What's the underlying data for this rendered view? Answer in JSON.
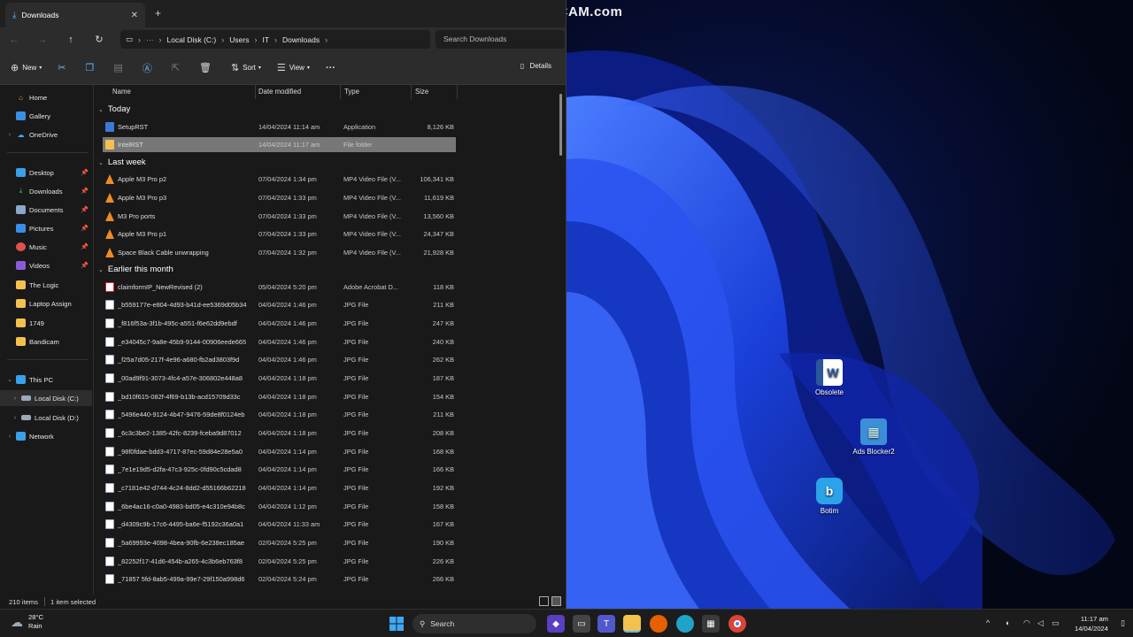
{
  "watermark": "www.BANDICAM.com",
  "explorer": {
    "tab_title": "Downloads",
    "breadcrumbs": [
      "Local Disk (C:)",
      "Users",
      "IT",
      "Downloads"
    ],
    "search_placeholder": "Search Downloads",
    "commands": {
      "new": "New",
      "sort": "Sort",
      "view": "View",
      "more": "···",
      "details": "Details"
    },
    "columns": {
      "name": "Name",
      "date": "Date modified",
      "type": "Type",
      "size": "Size"
    },
    "nav": {
      "home": "Home",
      "gallery": "Gallery",
      "onedrive": "OneDrive",
      "desktop": "Desktop",
      "downloads": "Downloads",
      "documents": "Documents",
      "pictures": "Pictures",
      "music": "Music",
      "videos": "Videos",
      "thelogic": "The Logic",
      "laptop": "Laptop Assign",
      "f1749": "1749",
      "bandicam": "Bandicam",
      "thispc": "This PC",
      "diskc": "Local Disk (C:)",
      "diskd": "Local Disk (D:)",
      "network": "Network"
    },
    "groups": {
      "today": "Today",
      "lastweek": "Last week",
      "earlier": "Earlier this month"
    },
    "files": [
      {
        "name": "SetupRST",
        "date": "14/04/2024 11:14 am",
        "type": "Application",
        "size": "8,126 KB",
        "kind": "app"
      },
      {
        "name": "IntelRST",
        "date": "14/04/2024 11:17 am",
        "type": "File folder",
        "size": "",
        "kind": "folder"
      },
      {
        "name": "Apple M3 Pro p2",
        "date": "07/04/2024 1:34 pm",
        "type": "MP4 Video File (V...",
        "size": "106,341 KB",
        "kind": "vlc"
      },
      {
        "name": "Apple M3 Pro p3",
        "date": "07/04/2024 1:33 pm",
        "type": "MP4 Video File (V...",
        "size": "11,619 KB",
        "kind": "vlc"
      },
      {
        "name": "M3 Pro ports",
        "date": "07/04/2024 1:33 pm",
        "type": "MP4 Video File (V...",
        "size": "13,560 KB",
        "kind": "vlc"
      },
      {
        "name": "Apple M3 Pro p1",
        "date": "07/04/2024 1:33 pm",
        "type": "MP4 Video File (V...",
        "size": "24,347 KB",
        "kind": "vlc"
      },
      {
        "name": "Space Black Cable unwrapping",
        "date": "07/04/2024 1:32 pm",
        "type": "MP4 Video File (V...",
        "size": "21,928 KB",
        "kind": "vlc"
      },
      {
        "name": "claimformIP_NewRevised (2)",
        "date": "05/04/2024 5:20 pm",
        "type": "Adobe Acrobat D...",
        "size": "118 KB",
        "kind": "pdf"
      },
      {
        "name": "_b559177e-e804-4d93-b41d-ee5369d05b34",
        "date": "04/04/2024 1:46 pm",
        "type": "JPG File",
        "size": "211 KB",
        "kind": "jpg"
      },
      {
        "name": "_f816f53a-3f1b-495c-a551-f6e62dd9ebdf",
        "date": "04/04/2024 1:46 pm",
        "type": "JPG File",
        "size": "247 KB",
        "kind": "jpg"
      },
      {
        "name": "_e34045c7-9a8e-45b9-9144-00906eede665",
        "date": "04/04/2024 1:46 pm",
        "type": "JPG File",
        "size": "240 KB",
        "kind": "jpg"
      },
      {
        "name": "_f25a7d05-217f-4e96-a680-fb2ad3803f9d",
        "date": "04/04/2024 1:46 pm",
        "type": "JPG File",
        "size": "262 KB",
        "kind": "jpg"
      },
      {
        "name": "_00ad9f91-3073-4fc4-a57e-306802e448a8",
        "date": "04/04/2024 1:18 pm",
        "type": "JPG File",
        "size": "187 KB",
        "kind": "jpg"
      },
      {
        "name": "_bd10f615-082f-4f69-b13b-acd15709d33c",
        "date": "04/04/2024 1:18 pm",
        "type": "JPG File",
        "size": "154 KB",
        "kind": "jpg"
      },
      {
        "name": "_5496e440-9124-4b47-9476-59de8f0124eb",
        "date": "04/04/2024 1:18 pm",
        "type": "JPG File",
        "size": "211 KB",
        "kind": "jpg"
      },
      {
        "name": "_6c3c3be2-1385-42fc-8239-fceba9d87012",
        "date": "04/04/2024 1:18 pm",
        "type": "JPG File",
        "size": "208 KB",
        "kind": "jpg"
      },
      {
        "name": "_98f0fdae-bdd3-4717-87ec-59d84e28e5a0",
        "date": "04/04/2024 1:14 pm",
        "type": "JPG File",
        "size": "168 KB",
        "kind": "jpg"
      },
      {
        "name": "_7e1e19d5-d2fa-47c3-925c-0fd90c5cdad8",
        "date": "04/04/2024 1:14 pm",
        "type": "JPG File",
        "size": "166 KB",
        "kind": "jpg"
      },
      {
        "name": "_c7181e42-d744-4c24-8dd2-d55166b62218",
        "date": "04/04/2024 1:14 pm",
        "type": "JPG File",
        "size": "192 KB",
        "kind": "jpg"
      },
      {
        "name": "_6be4ac16-c0a0-4983-bd05-e4c310e94b8c",
        "date": "04/04/2024 1:12 pm",
        "type": "JPG File",
        "size": "158 KB",
        "kind": "jpg"
      },
      {
        "name": "_d4309c9b-17c6-4495-ba6e-f5192c36a0a1",
        "date": "04/04/2024 11:33 am",
        "type": "JPG File",
        "size": "167 KB",
        "kind": "jpg"
      },
      {
        "name": "_5a69993e-4098-4bea-90fb-6e238ec185ae",
        "date": "02/04/2024 5:25 pm",
        "type": "JPG File",
        "size": "190 KB",
        "kind": "jpg"
      },
      {
        "name": "_82252f17-41d6-454b-a265-4c3b6eb763f8",
        "date": "02/04/2024 5:25 pm",
        "type": "JPG File",
        "size": "226 KB",
        "kind": "jpg"
      },
      {
        "name": "_71857 5fd-8ab5-499a-99e7-29f150a998d6",
        "date": "02/04/2024 5:24 pm",
        "type": "JPG File",
        "size": "266 KB",
        "kind": "jpg"
      }
    ],
    "status": {
      "count": "210 items",
      "selected": "1 item selected"
    }
  },
  "desktop_icons": [
    {
      "label": "Obsolete",
      "icon": "word-icon",
      "color": "#2b579a",
      "glyph": "W"
    },
    {
      "label": "Ads Blocker2",
      "icon": "cubes-icon",
      "color": "#3b8fd6",
      "glyph": "▦"
    },
    {
      "label": "Botim",
      "icon": "botim-icon",
      "color": "#2aa3e8",
      "glyph": "b"
    }
  ],
  "taskbar": {
    "temp": "28°C",
    "weather": "Rain",
    "search": "Search",
    "time": "11:17 am",
    "date": "14/04/2024"
  }
}
